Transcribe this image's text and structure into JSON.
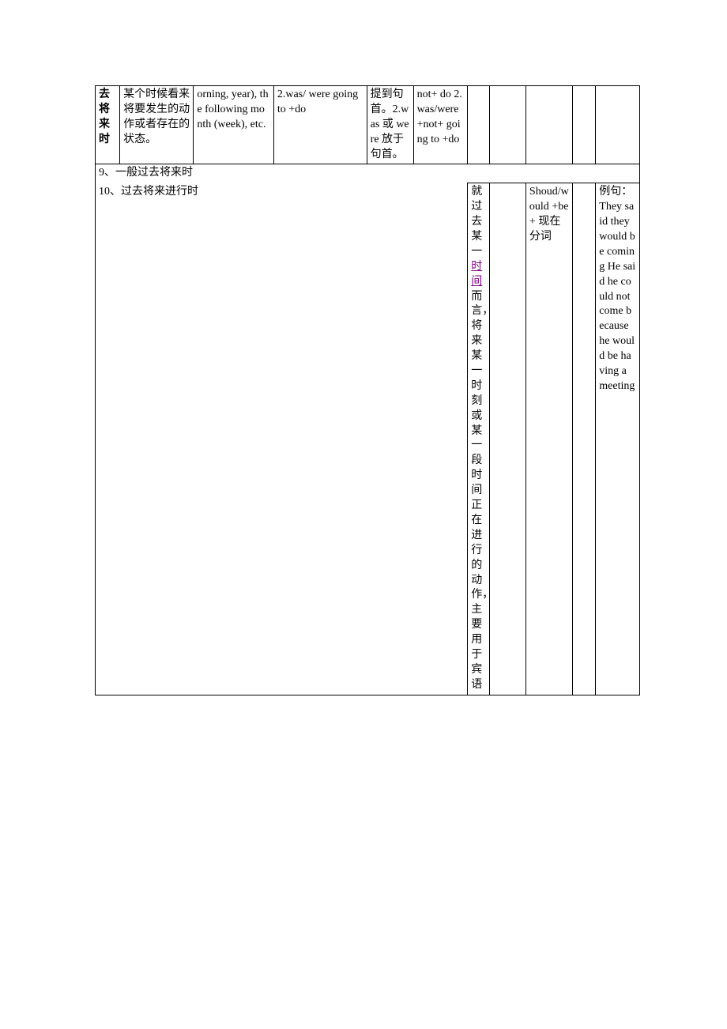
{
  "table": {
    "row1": {
      "c1": "去将来时",
      "c2": "某个时候看来将要发生的动作或者存在的状态。",
      "c3": "orning, year), the following month (week), etc.",
      "c4": "2.was/ were going to +do",
      "c5": "提到句首。2.was 或 were 放于句首。",
      "c6": "not+ do 2.was/were +not+ going to +do"
    },
    "header9": "9、一般过去将来时",
    "header10": "10、过去将来进行时",
    "row2": {
      "c7_pre": "就过去某一",
      "c7_link": "时间",
      "c7_post": "而言，将来某一时刻或某一段时间正在进行的动作，主要用于宾语",
      "c9": "Shoud/would +be+ 现在分词",
      "c11": "例句：They said they would be coming He said he could not come because he would be having a meeting"
    }
  }
}
